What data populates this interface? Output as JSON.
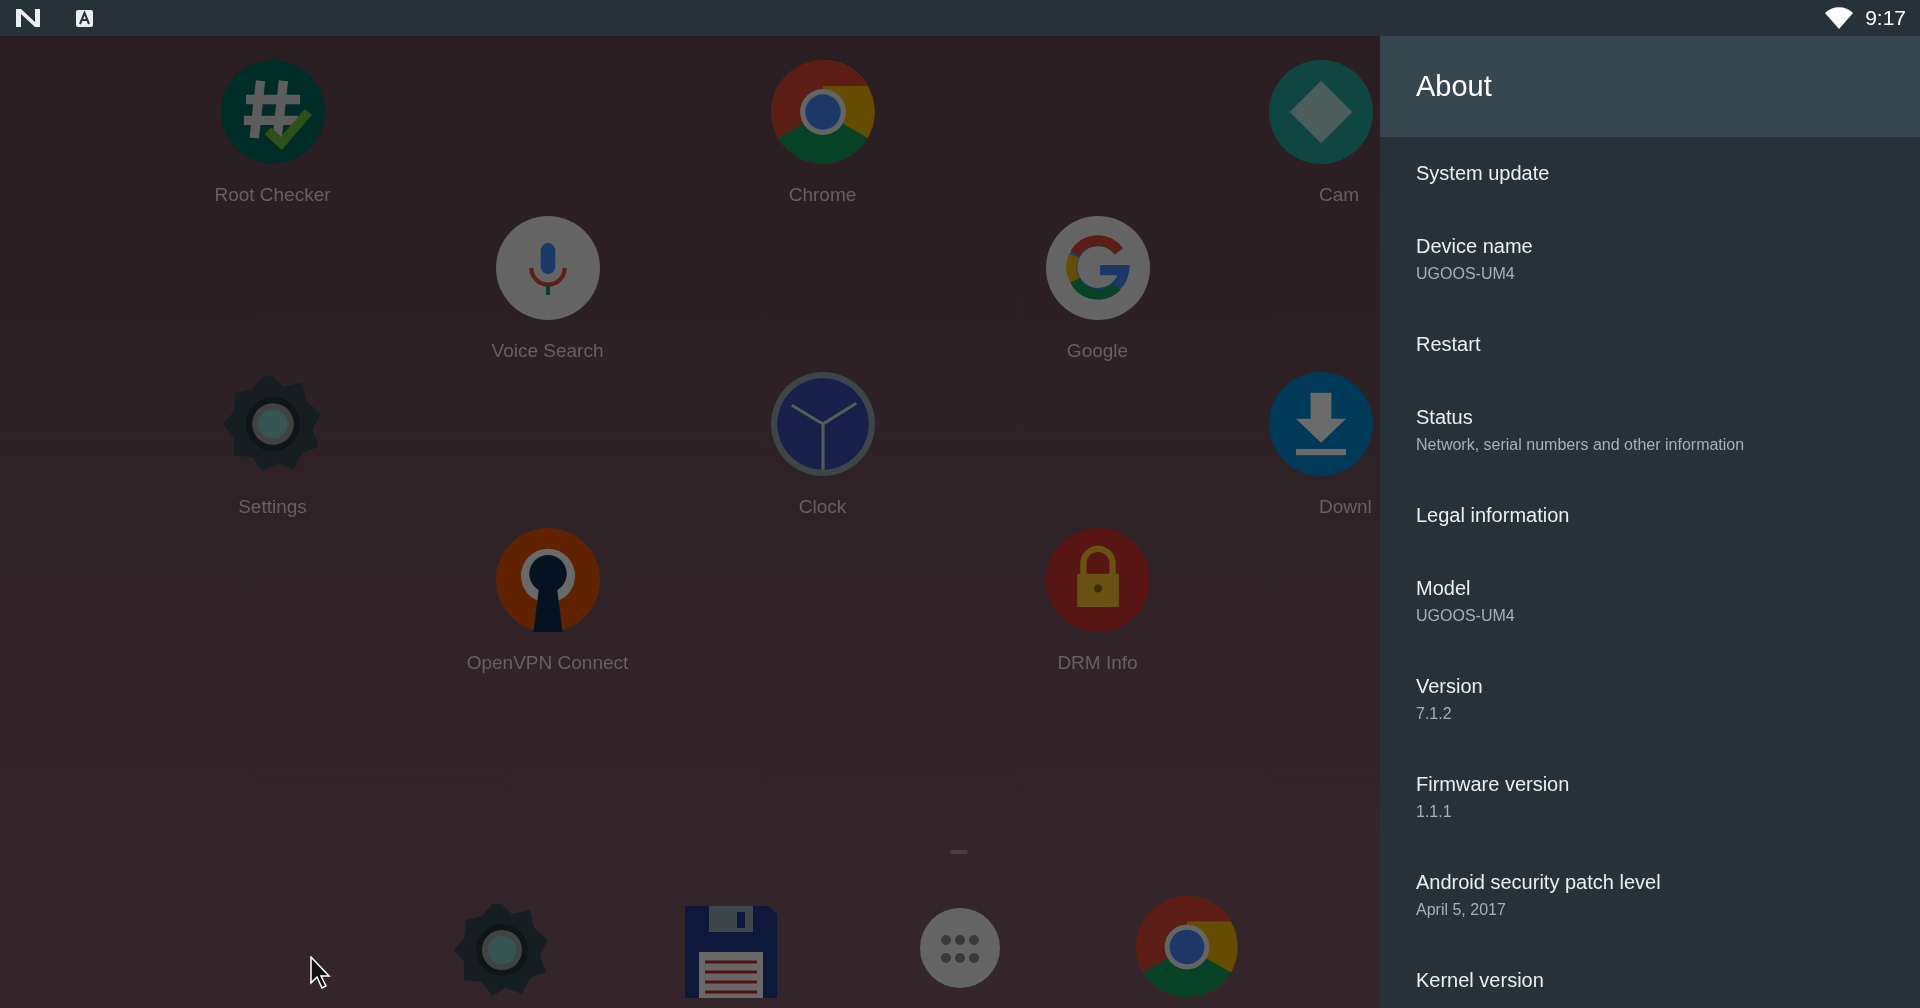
{
  "status_bar": {
    "time": "9:17"
  },
  "launcher": {
    "rows": [
      [
        {
          "kind": "app",
          "label": "Root Checker"
        },
        {
          "kind": "empty"
        },
        {
          "kind": "app",
          "label": "Chrome"
        },
        {
          "kind": "empty"
        },
        {
          "kind": "clipped",
          "label": "Cam"
        }
      ],
      [
        {
          "kind": "empty"
        },
        {
          "kind": "app",
          "label": "Voice Search"
        },
        {
          "kind": "empty"
        },
        {
          "kind": "app",
          "label": "Google"
        },
        {
          "kind": "empty"
        }
      ],
      [
        {
          "kind": "app",
          "label": "Settings"
        },
        {
          "kind": "empty"
        },
        {
          "kind": "app",
          "label": "Clock"
        },
        {
          "kind": "empty"
        },
        {
          "kind": "clipped",
          "label": "Downl"
        }
      ],
      [
        {
          "kind": "empty"
        },
        {
          "kind": "app",
          "label": "OpenVPN Connect"
        },
        {
          "kind": "empty"
        },
        {
          "kind": "app",
          "label": "DRM Info"
        },
        {
          "kind": "empty"
        }
      ]
    ]
  },
  "settings_panel": {
    "title": "About",
    "items": [
      {
        "title": "System update"
      },
      {
        "title": "Device name",
        "summary": "UGOOS-UM4"
      },
      {
        "title": "Restart"
      },
      {
        "title": "Status",
        "summary": "Network, serial numbers and other information"
      },
      {
        "title": "Legal information"
      },
      {
        "title": "Model",
        "summary": "UGOOS-UM4"
      },
      {
        "title": "Version",
        "summary": "7.1.2"
      },
      {
        "title": "Firmware version",
        "summary": "1.1.1"
      },
      {
        "title": "Android security patch level",
        "summary": "April 5, 2017"
      },
      {
        "title": "Kernel version"
      }
    ]
  }
}
